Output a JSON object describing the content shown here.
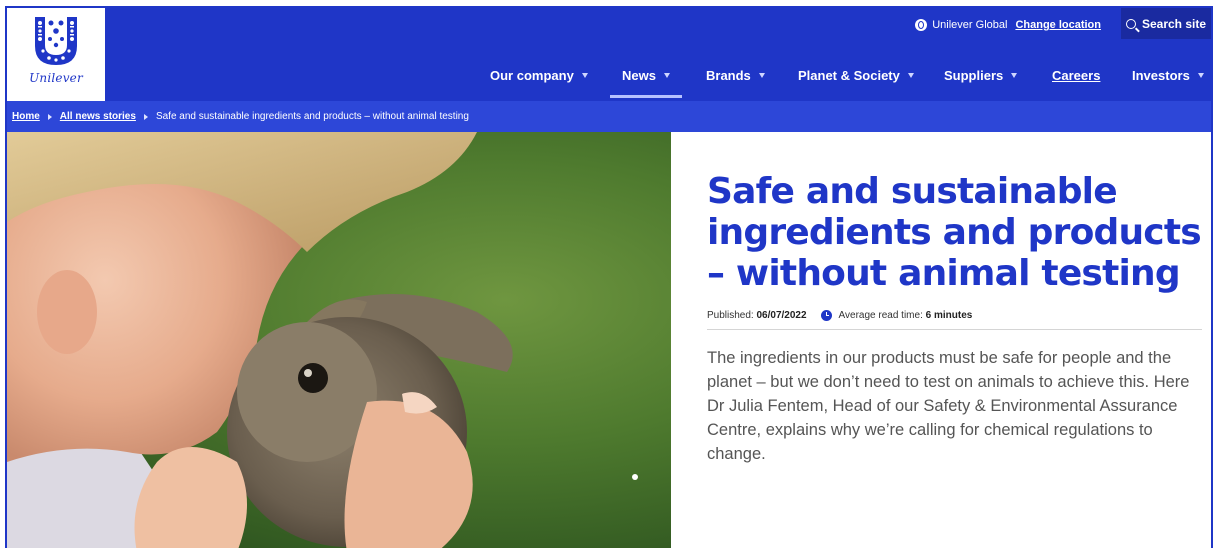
{
  "brand": {
    "name": "Unilever",
    "color": "#1f36c7"
  },
  "utility": {
    "location_label": "Unilever Global",
    "change_location": "Change location",
    "search_label": "Search site"
  },
  "nav": {
    "items": [
      {
        "label": "Our company",
        "dropdown": true
      },
      {
        "label": "News",
        "dropdown": true,
        "active": true
      },
      {
        "label": "Brands",
        "dropdown": true
      },
      {
        "label": "Planet & Society",
        "dropdown": true
      },
      {
        "label": "Suppliers",
        "dropdown": true
      },
      {
        "label": "Careers",
        "dropdown": false
      },
      {
        "label": "Investors",
        "dropdown": true
      }
    ]
  },
  "breadcrumb": {
    "items": [
      "Home",
      "All news stories",
      "Safe and sustainable ingredients and products – without animal testing"
    ]
  },
  "article": {
    "title": "Safe and sustainable ingredients and products – without animal testing",
    "published_label": "Published:",
    "published_date": "06/07/2022",
    "read_time_label": "Average read time:",
    "read_time": "6 minutes",
    "intro": "The ingredients in our products must be safe for people and the planet – but we don’t need to test on animals to achieve this. Here Dr Julia Fentem, Head of our Safety & Environmental Assurance Centre, explains why we’re calling for chemical regulations to change."
  }
}
